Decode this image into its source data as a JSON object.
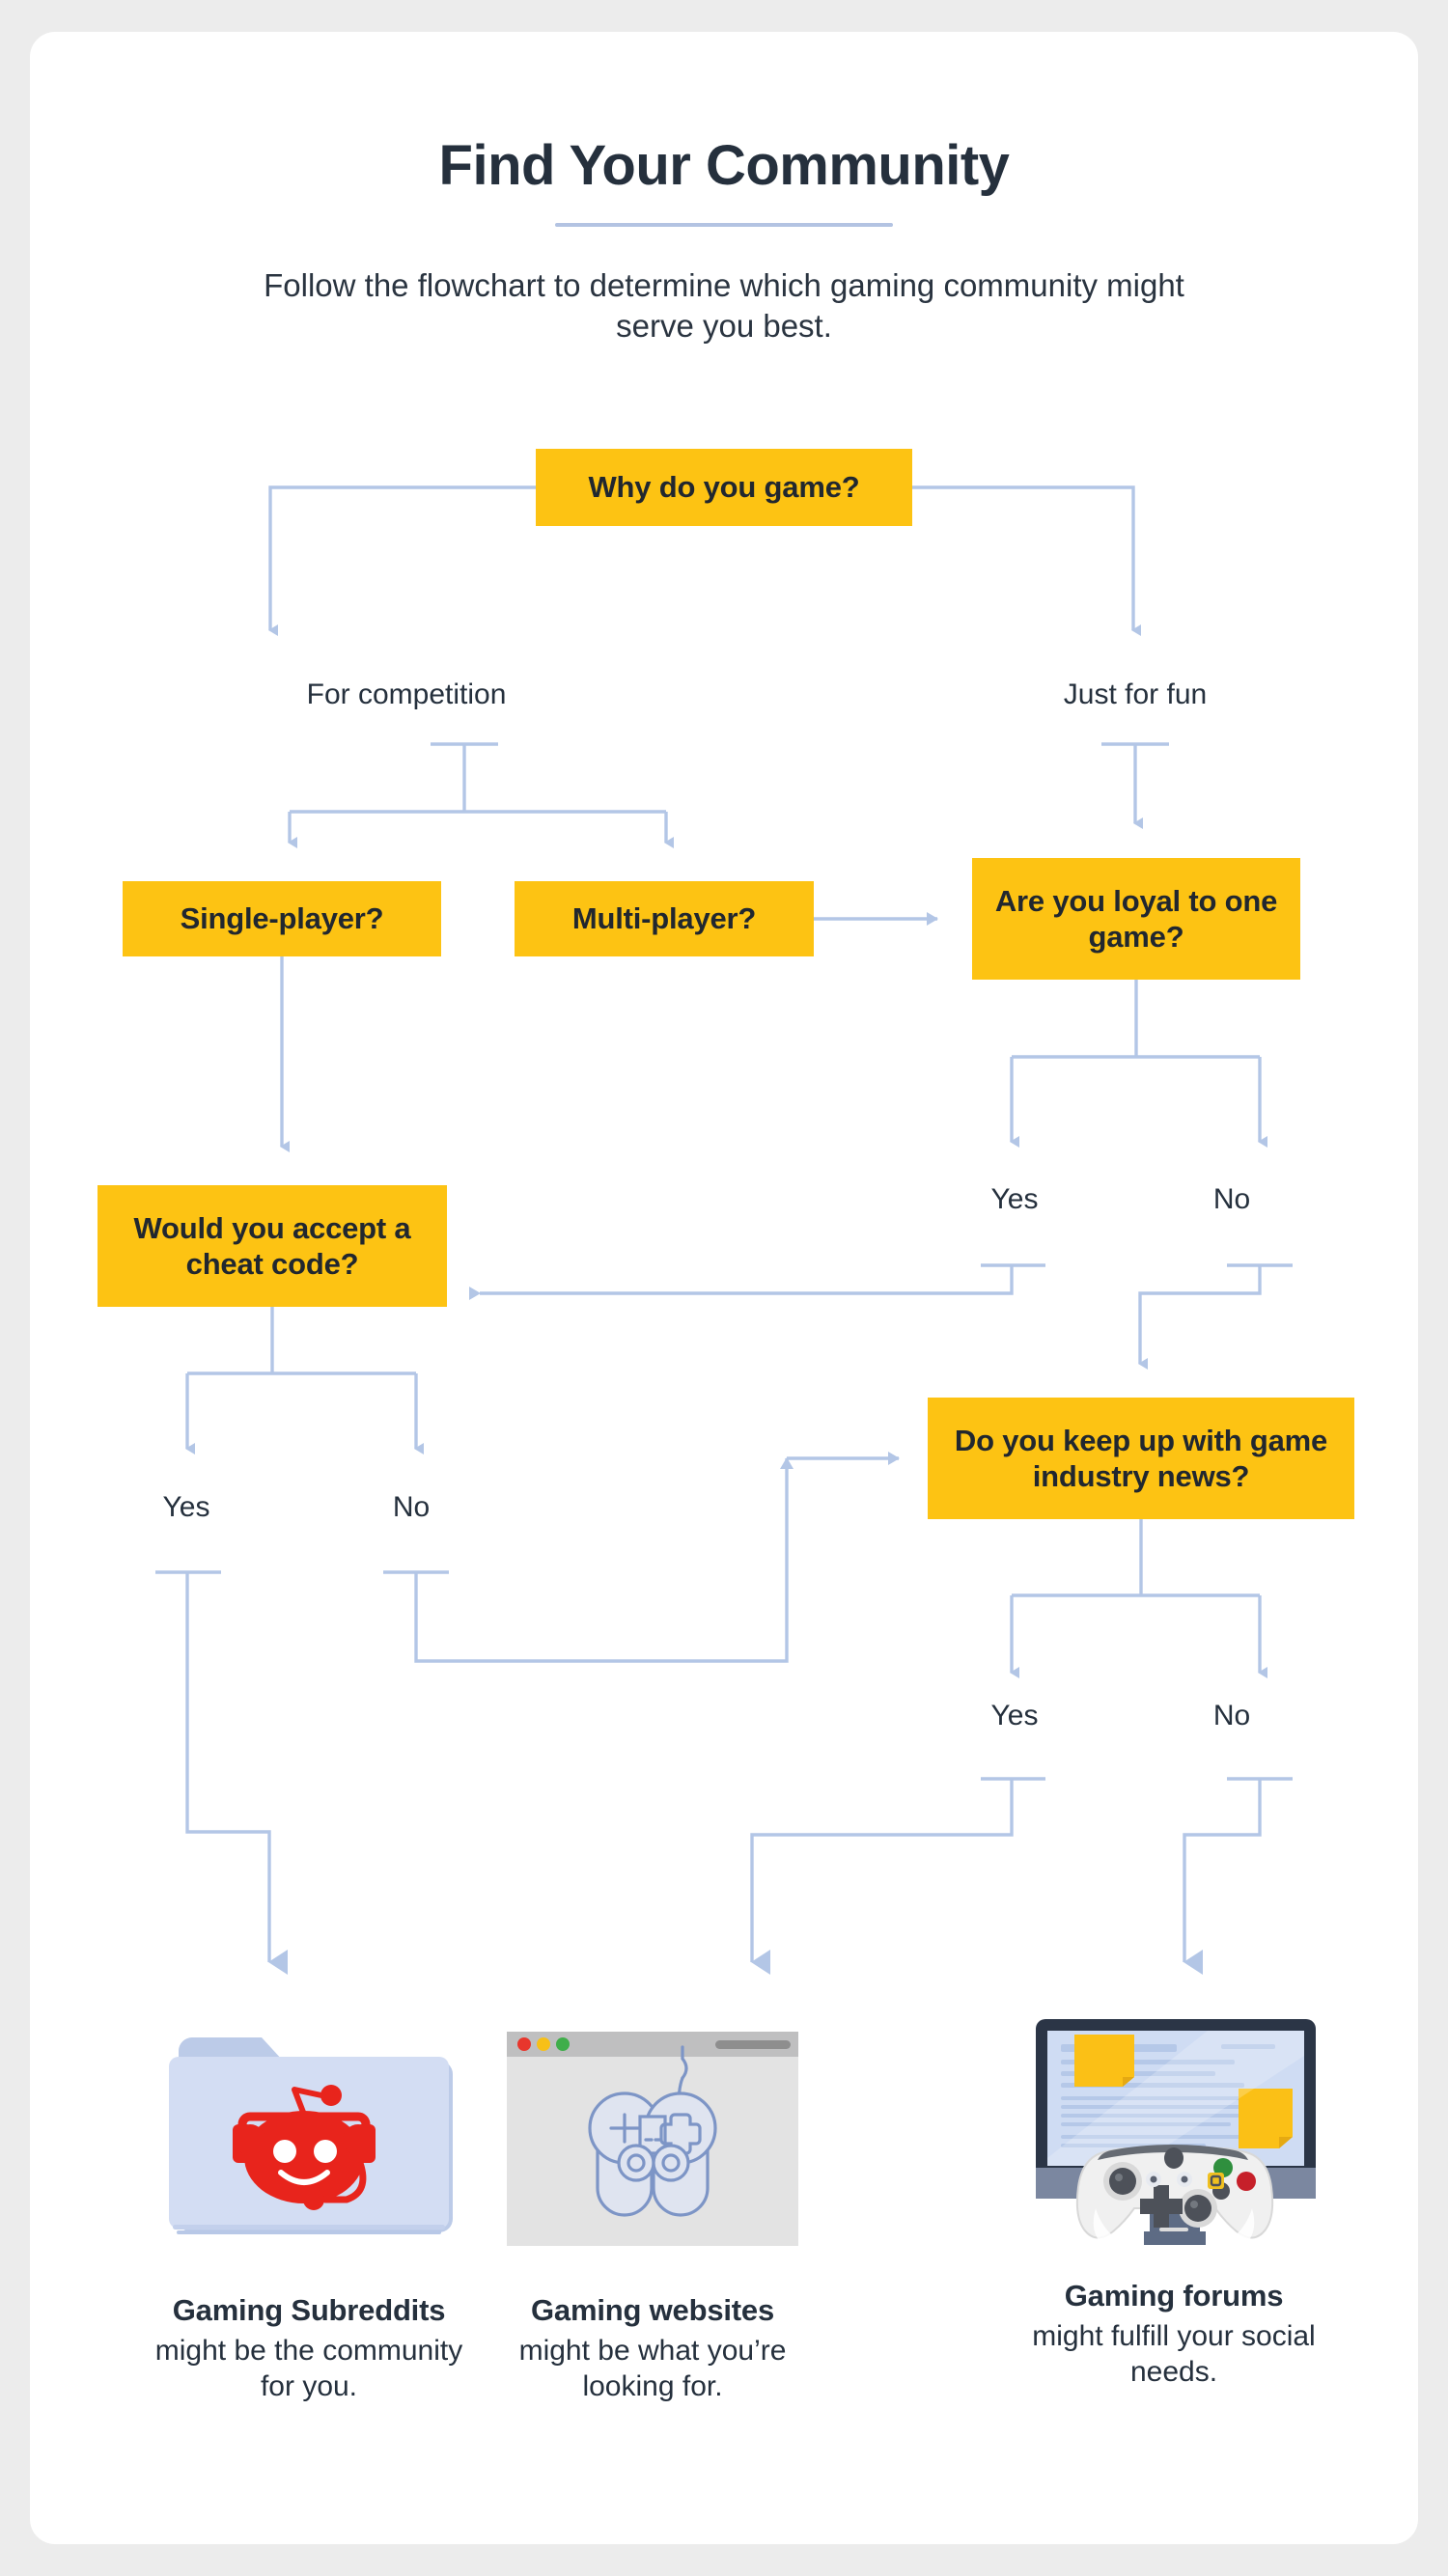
{
  "header": {
    "title": "Find Your Community",
    "subtitle": "Follow the flowchart to determine which gaming community might serve you best."
  },
  "colors": {
    "page_background": "#ececec",
    "card_background": "#ffffff",
    "node_fill": "#FDC313",
    "node_text": "#21272f",
    "connector": "#b3c6e6",
    "title_rule": "#b3c3e2",
    "body_text": "#25303d",
    "reddit_red": "#e8241c"
  },
  "flowchart": {
    "type": "decision-tree",
    "nodes": [
      {
        "id": "why",
        "label": "Why do you game?"
      },
      {
        "id": "single",
        "label": "Single-player?"
      },
      {
        "id": "multi",
        "label": "Multi-player?"
      },
      {
        "id": "loyal",
        "label": "Are you loyal to one game?"
      },
      {
        "id": "cheat",
        "label": "Would you accept a cheat code?"
      },
      {
        "id": "news",
        "label": "Do you keep up with game industry news?"
      }
    ],
    "edge_labels": {
      "why_left": "For competition",
      "why_right": "Just for fun",
      "loyal_yes": "Yes",
      "loyal_no": "No",
      "cheat_yes": "Yes",
      "cheat_no": "No",
      "news_yes": "Yes",
      "news_no": "No"
    },
    "edges": [
      {
        "from": "why",
        "to": "single",
        "label": "For competition"
      },
      {
        "from": "why",
        "to": "multi",
        "label": "For competition"
      },
      {
        "from": "why",
        "to": "loyal",
        "label": "Just for fun"
      },
      {
        "from": "multi",
        "to": "loyal",
        "label": ""
      },
      {
        "from": "single",
        "to": "cheat",
        "label": ""
      },
      {
        "from": "loyal",
        "to": "cheat",
        "label": "Yes"
      },
      {
        "from": "loyal",
        "to": "news",
        "label": "No"
      },
      {
        "from": "cheat",
        "to": "subreddits",
        "label": "Yes"
      },
      {
        "from": "cheat",
        "to": "news",
        "label": "No"
      },
      {
        "from": "news",
        "to": "websites",
        "label": "Yes"
      },
      {
        "from": "news",
        "to": "forums",
        "label": "No"
      }
    ]
  },
  "results": [
    {
      "icon": "reddit-folder-icon",
      "title": "Gaming Subreddits",
      "subtitle": "might be the community for you."
    },
    {
      "icon": "browser-gamepad-icon",
      "title": "Gaming websites",
      "subtitle": "might be what you’re looking for."
    },
    {
      "icon": "monitor-controller-icon",
      "title": "Gaming forums",
      "subtitle": "might fulfill your social needs."
    }
  ]
}
